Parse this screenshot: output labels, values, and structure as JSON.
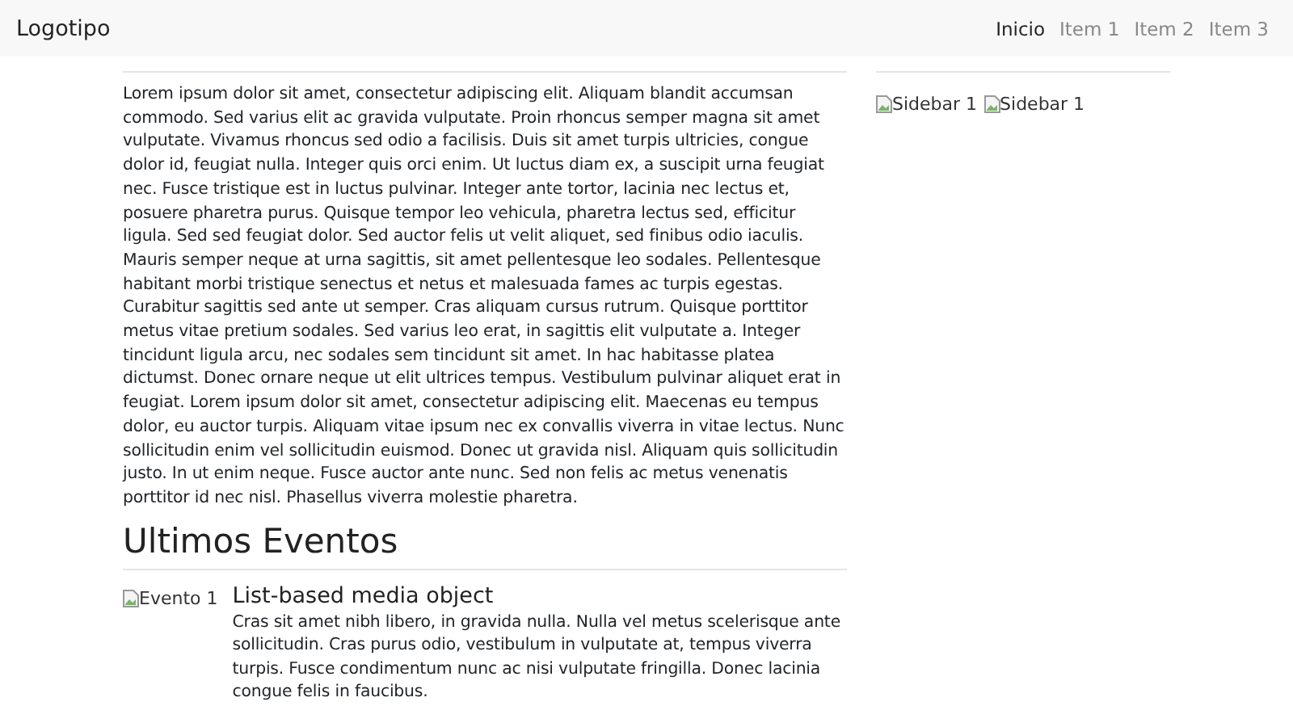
{
  "navbar": {
    "brand": "Logotipo",
    "items": [
      {
        "label": "Inicio",
        "selected": true
      },
      {
        "label": "Item 1",
        "selected": false
      },
      {
        "label": "Item 2",
        "selected": false
      },
      {
        "label": "Item 3",
        "selected": false
      }
    ]
  },
  "main": {
    "paragraph": "Lorem ipsum dolor sit amet, consectetur adipiscing elit. Aliquam blandit accumsan commodo. Sed varius elit ac gravida vulputate. Proin rhoncus semper magna sit amet vulputate. Vivamus rhoncus sed odio a facilisis. Duis sit amet turpis ultricies, congue dolor id, feugiat nulla. Integer quis orci enim. Ut luctus diam ex, a suscipit urna feugiat nec. Fusce tristique est in luctus pulvinar. Integer ante tortor, lacinia nec lectus et, posuere pharetra purus. Quisque tempor leo vehicula, pharetra lectus sed, efficitur ligula. Sed sed feugiat dolor. Sed auctor felis ut velit aliquet, sed finibus odio iaculis. Mauris semper neque at urna sagittis, sit amet pellentesque leo sodales. Pellentesque habitant morbi tristique senectus et netus et malesuada fames ac turpis egestas. Curabitur sagittis sed ante ut semper. Cras aliquam cursus rutrum. Quisque porttitor metus vitae pretium sodales. Sed varius leo erat, in sagittis elit vulputate a. Integer tincidunt ligula arcu, nec sodales sem tincidunt sit amet. In hac habitasse platea dictumst. Donec ornare neque ut elit ultrices tempus. Vestibulum pulvinar aliquet erat in feugiat. Lorem ipsum dolor sit amet, consectetur adipiscing elit. Maecenas eu tempus dolor, eu auctor turpis. Aliquam vitae ipsum nec ex convallis viverra in vitae lectus. Nunc sollicitudin enim vel sollicitudin euismod. Donec ut gravida nisl. Aliquam quis sollicitudin justo. In ut enim neque. Fusce auctor ante nunc. Sed non felis ac metus venenatis porttitor id nec nisl. Phasellus viverra molestie pharetra.",
    "events_heading": "Ultimos Eventos",
    "events": [
      {
        "image_alt": "Evento 1",
        "title": "List-based media object",
        "body": "Cras sit amet nibh libero, in gravida nulla. Nulla vel metus scelerisque ante sollicitudin. Cras purus odio, vestibulum in vulputate at, tempus viverra turpis. Fusce condimentum nunc ac nisi vulputate fringilla. Donec lacinia congue felis in faucibus."
      }
    ]
  },
  "sidebar": {
    "images": [
      {
        "alt": "Sidebar 1"
      },
      {
        "alt": "Sidebar 1"
      }
    ]
  }
}
